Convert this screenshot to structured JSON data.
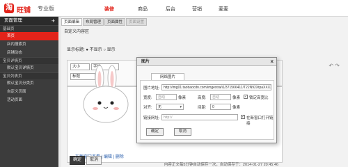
{
  "header": {
    "logo_glyph": "淘",
    "brand": "旺铺",
    "edition": "专业版",
    "nav": [
      {
        "label": "装修",
        "active": true
      },
      {
        "label": "商品",
        "active": false
      },
      {
        "label": "后台",
        "active": false
      },
      {
        "label": "营销",
        "active": false
      },
      {
        "label": "麦麦",
        "active": false
      }
    ]
  },
  "sidebar": {
    "title": "页面管理",
    "add_glyph": "+",
    "sections": [
      {
        "group": "基础页",
        "items": [
          "首页",
          "店内搜索页",
          "店铺动态"
        ]
      },
      {
        "group": "宝贝详情页",
        "items": [
          "默认宝贝详情页"
        ]
      },
      {
        "group": "宝贝列表页",
        "items": [
          "默认宝贝分类页"
        ]
      },
      {
        "group": "",
        "items": [
          "自定义页面",
          "活动页面"
        ]
      }
    ]
  },
  "main": {
    "tabs": [
      "页面编辑",
      "布局管理",
      "页面属性",
      "页面设置"
    ],
    "panel_title": "自定义内容区",
    "show_title_label": "显示标题:",
    "radio_hide": "不显示",
    "radio_show": "显示",
    "font_size_select": "大小",
    "font_select": "字体",
    "heading_select": "标题",
    "caption": "在新窗口查看 | 编辑 | 删除",
    "status": "内容正文每5分钟自动保存一次，自动保存于：2014-01-27 20:45:46",
    "confirm_label": "确定",
    "cancel_label": "取消"
  },
  "dialog": {
    "title": "图片",
    "close_glyph": "×",
    "tab_label": "网络图片",
    "url_label": "图片地址:",
    "url_value": "http://img01.taobaocdn.com/imgextra/i1/371566411/T22N92XtpaXXXXXXXXX",
    "width_label": "宽度:",
    "width_placeholder": "自动",
    "width_unit": "像素",
    "height_label": "高度:",
    "height_placeholder": "自动",
    "height_unit": "像素",
    "lock_ratio_label": "锁定高宽比",
    "align_label": "对齐:",
    "align_value": "无",
    "spacing_label": "间距:",
    "spacing_value": "0",
    "spacing_unit": "像素",
    "link_label": "链接网址:",
    "link_placeholder": "http://",
    "new_window_label": "在新窗口打开链接",
    "ok_label": "确定",
    "cancel_label": "取消"
  }
}
